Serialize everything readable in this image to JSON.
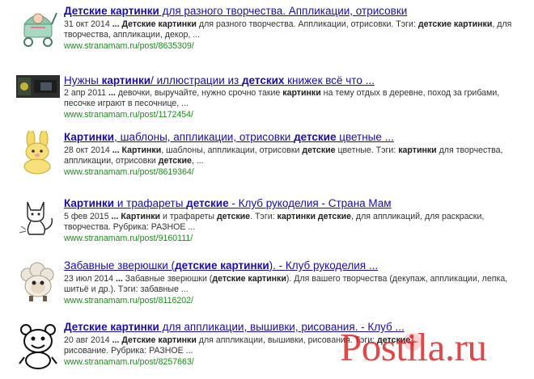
{
  "results": [
    {
      "title": [
        {
          "t": "Детские картинки",
          "b": true
        },
        {
          "t": " для разного творчества. Аппликации, отрисовки",
          "b": false
        }
      ],
      "snippet1": [
        {
          "t": "31 окт 2014 ",
          "b": false
        },
        {
          "t": "...",
          "b": true
        },
        {
          "t": " ",
          "b": false
        },
        {
          "t": "Детские картинки",
          "b": true
        },
        {
          "t": " для разного творчества. Аппликации, отрисовки. Тэги: ",
          "b": false
        },
        {
          "t": "детские картинки",
          "b": true
        },
        {
          "t": ", для",
          "b": false
        }
      ],
      "snippet2": [
        {
          "t": "творчества, аппликации, декор, ...",
          "b": false
        }
      ],
      "url": "www.stranamam.ru/post/8635309/",
      "thumb_icon": "stroller-doll-thumbnail"
    },
    {
      "title": [
        {
          "t": "Нужны ",
          "b": false
        },
        {
          "t": "картинки",
          "b": true
        },
        {
          "t": "/ иллюстрации из ",
          "b": false
        },
        {
          "t": "детских",
          "b": true
        },
        {
          "t": " книжек всё что ...",
          "b": false
        }
      ],
      "snippet1": [
        {
          "t": "2 апр 2011 ",
          "b": false
        },
        {
          "t": "...",
          "b": true
        },
        {
          "t": " девочки, выручайте, нужно срочно такие ",
          "b": false
        },
        {
          "t": "картинки",
          "b": true
        },
        {
          "t": " на тему отдых в деревне, поход за грибами,",
          "b": false
        }
      ],
      "snippet2": [
        {
          "t": "песочке играют в песочнице, ...",
          "b": false
        }
      ],
      "url": "www.stranamam.ru/post/1172454/",
      "thumb_icon": "dark-photo-thumbnail"
    },
    {
      "title": [
        {
          "t": "Картинки",
          "b": true
        },
        {
          "t": ", шаблоны, аппликации, отрисовки ",
          "b": false
        },
        {
          "t": "детские",
          "b": true
        },
        {
          "t": " цветные ...",
          "b": false
        }
      ],
      "snippet1": [
        {
          "t": "28 окт 2014 ",
          "b": false
        },
        {
          "t": "...",
          "b": true
        },
        {
          "t": " ",
          "b": false
        },
        {
          "t": "Картинки",
          "b": true
        },
        {
          "t": ", шаблоны, аппликации, отрисовки ",
          "b": false
        },
        {
          "t": "детские",
          "b": true
        },
        {
          "t": " цветные. Тэги: ",
          "b": false
        },
        {
          "t": "картинки",
          "b": true
        },
        {
          "t": " для творчества,",
          "b": false
        }
      ],
      "snippet2": [
        {
          "t": "аппликации, отрисовки ",
          "b": false
        },
        {
          "t": "детские",
          "b": true
        },
        {
          "t": ", ...",
          "b": false
        }
      ],
      "url": "www.stranamam.ru/post/8619364/",
      "thumb_icon": "yellow-bunny-thumbnail"
    },
    {
      "title": [
        {
          "t": "Картинки",
          "b": true
        },
        {
          "t": " и трафареты ",
          "b": false
        },
        {
          "t": "детские",
          "b": true
        },
        {
          "t": " - Клуб рукоделия - Страна Мам",
          "b": false
        }
      ],
      "snippet1": [
        {
          "t": "5 фев 2015 ",
          "b": false
        },
        {
          "t": "...",
          "b": true
        },
        {
          "t": " ",
          "b": false
        },
        {
          "t": "Картинки",
          "b": true
        },
        {
          "t": " и трафареты ",
          "b": false
        },
        {
          "t": "детские",
          "b": true
        },
        {
          "t": ". Тэги: ",
          "b": false
        },
        {
          "t": "картинки детские",
          "b": true
        },
        {
          "t": ", для аппликаций, для раскраски,",
          "b": false
        }
      ],
      "snippet2": [
        {
          "t": "творчества. Рубрика: РАЗНОЕ ...",
          "b": false
        }
      ],
      "url": "www.stranamam.ru/post/9160111/",
      "thumb_icon": "cat-outline-thumbnail"
    },
    {
      "title": [
        {
          "t": "Забавные зверюшки (",
          "b": false
        },
        {
          "t": "детские картинки",
          "b": true
        },
        {
          "t": "). - Клуб рукоделия ...",
          "b": false
        }
      ],
      "snippet1": [
        {
          "t": "23 июл 2014 ",
          "b": false
        },
        {
          "t": "...",
          "b": true
        },
        {
          "t": " Забавные зверюшки (",
          "b": false
        },
        {
          "t": "детские картинки",
          "b": true
        },
        {
          "t": "). Для вашего творчества (декупаж, аппликации, лепка,",
          "b": false
        }
      ],
      "snippet2": [
        {
          "t": "шитьё и др.). Тэги: забавные ...",
          "b": false
        }
      ],
      "url": "www.stranamam.ru/post/8116202/",
      "thumb_icon": "sheep-thumbnail"
    },
    {
      "title": [
        {
          "t": "Детские картинки",
          "b": true
        },
        {
          "t": " для аппликации, вышивки, рисования. - Клуб ...",
          "b": false
        }
      ],
      "snippet1": [
        {
          "t": "20 авг 2014 ",
          "b": false
        },
        {
          "t": "...",
          "b": true
        },
        {
          "t": " ",
          "b": false
        },
        {
          "t": "Детские картинки",
          "b": true
        },
        {
          "t": " для аппликации, вышивки, рисования. Тэги: ",
          "b": false
        },
        {
          "t": "детские",
          "b": true
        }
      ],
      "snippet2": [
        {
          "t": "рисование. Рубрика: РАЗНОЕ ...",
          "b": false
        }
      ],
      "url": "www.stranamam.ru/post/8257663/",
      "thumb_icon": "cartoon-bear-thumbnail"
    }
  ],
  "watermark": {
    "text": "Postila.ru",
    "icon": "postila-logo-icon",
    "color": "#d61818"
  },
  "colors": {
    "link": "#1a0dab",
    "url": "#1a8c1a",
    "snippet": "#333333"
  }
}
